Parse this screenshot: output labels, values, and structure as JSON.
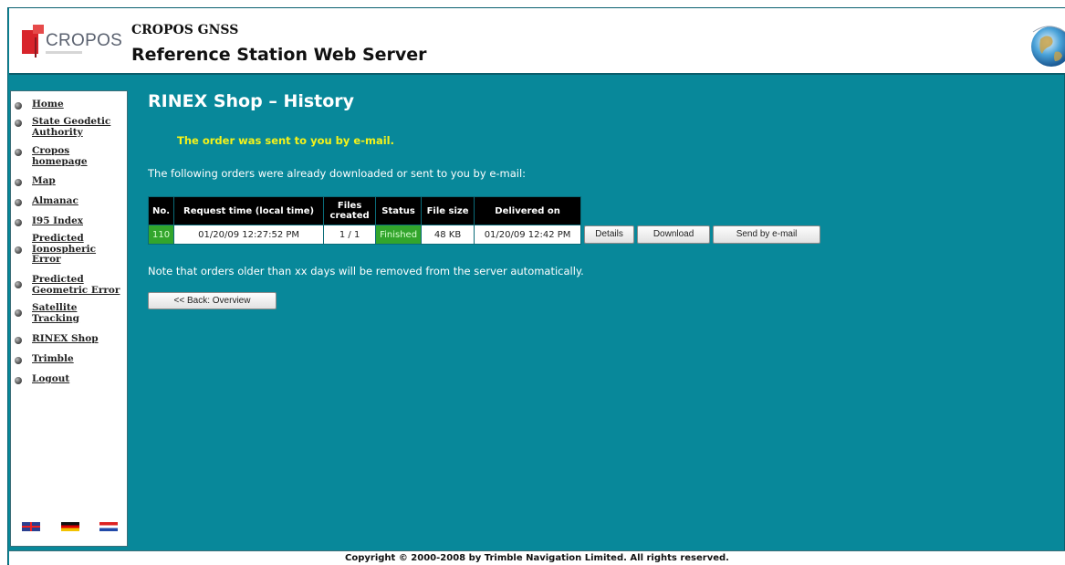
{
  "header": {
    "logo_text": "CROPOS",
    "title_small": "CROPOS GNSS",
    "title_big": "Reference Station Web Server"
  },
  "sidebar": {
    "items": [
      {
        "label": "Home"
      },
      {
        "label": "State Geodetic Authority"
      },
      {
        "label": "Cropos homepage"
      },
      {
        "label": "Map"
      },
      {
        "label": "Almanac"
      },
      {
        "label": "I95 Index"
      },
      {
        "label": "Predicted Ionospheric Error"
      },
      {
        "label": "Predicted Geometric Error"
      },
      {
        "label": "Satellite Tracking"
      },
      {
        "label": "RINEX Shop"
      },
      {
        "label": "Trimble"
      },
      {
        "label": "Logout"
      }
    ],
    "flags": [
      "uk-flag-icon",
      "germany-flag-icon",
      "croatia-flag-icon"
    ]
  },
  "main": {
    "title": "RINEX Shop – History",
    "confirmation": "The order was sent to you by e-mail.",
    "intro": "The following orders were already downloaded or sent to you by e-mail:",
    "note": "Note that orders older than xx days will be removed from the server automatically.",
    "back_button": "<< Back: Overview",
    "table": {
      "headers": [
        "No.",
        "Request time (local time)",
        "Files created",
        "Status",
        "File size",
        "Delivered on"
      ],
      "rows": [
        {
          "no": "110",
          "request_time": "01/20/09 12:27:52 PM",
          "files_created": "1 / 1",
          "status": "Finished",
          "file_size": "48 KB",
          "delivered_on": "01/20/09 12:42 PM",
          "buttons": {
            "details": "Details",
            "download": "Download",
            "send": "Send by e-mail"
          }
        }
      ]
    }
  },
  "footer": {
    "copyright": "Copyright © 2000-2008 by Trimble Navigation Limited. All rights reserved."
  },
  "colors": {
    "background": "#08889a",
    "status_green": "#32a52c",
    "confirmation_yellow": "#f4f21a"
  }
}
